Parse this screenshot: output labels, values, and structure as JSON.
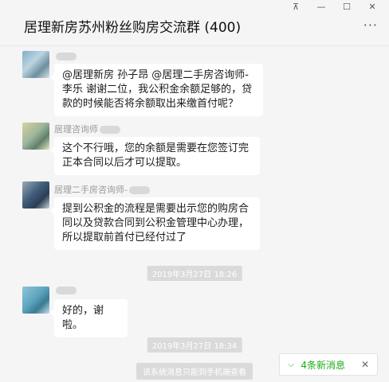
{
  "header": {
    "title": "居理新房苏州粉丝购房交流群 (400)",
    "pin_icon": "pin-icon",
    "minimize_icon": "minimize-icon",
    "maximize_icon": "maximize-icon",
    "close_icon": "close-icon",
    "more_icon": "more-icon"
  },
  "messages": [
    {
      "sender": "",
      "text": "@居理新房 孙子昂 @居理二手房咨询师-李乐 谢谢二位，我公积金余额足够的，贷款的时候能否将余额取出来缴首付呢？"
    },
    {
      "sender": "居理咨询师",
      "text": "这个不行哦，您的余额是需要在您签订完正本合同以后才可以提取。"
    },
    {
      "sender": "居理二手房咨询师-",
      "text": "提到公积金的流程是需要出示您的购房合同以及贷款合同到公积金管理中心办理，所以提取前首付已经付过了"
    },
    {
      "sender": "",
      "text": "好的，谢啦。"
    }
  ],
  "timestamps": [
    "2019年3月27日  18:26",
    "2019年3月27日  18:34"
  ],
  "system_notice": "该系统消息只能到手机端查看",
  "new_messages": {
    "label": "4条新消息",
    "icon": "chevron-down-icon",
    "close_icon": "close-icon"
  },
  "colors": {
    "accent": "#1aad19",
    "background": "#f5f5f5",
    "bubble": "#ffffff"
  }
}
